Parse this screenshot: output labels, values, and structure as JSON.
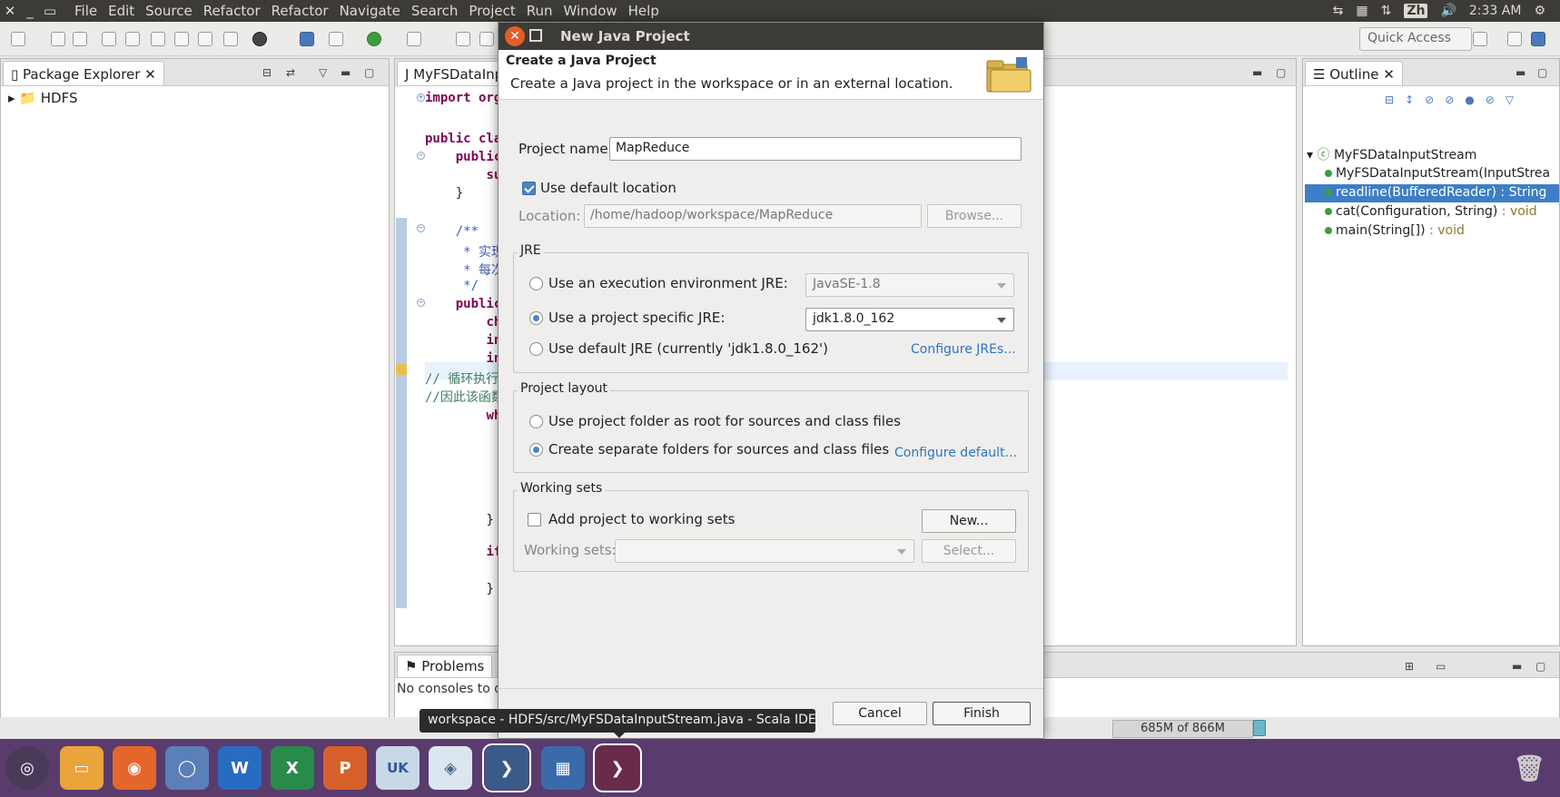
{
  "menubar": {
    "items": [
      "File",
      "Edit",
      "Source",
      "Refactor",
      "Refactor",
      "Navigate",
      "Search",
      "Project",
      "Run",
      "Window",
      "Help"
    ],
    "ime": "Zh",
    "clock": "2:33 AM"
  },
  "toolbar": {
    "quick_access": "Quick Access"
  },
  "package_explorer": {
    "tab": "Package Explorer",
    "tree": [
      {
        "label": "HDFS"
      }
    ]
  },
  "editor": {
    "tab": "MyFSDataInp",
    "lines": [
      "import org",
      "public cla",
      "public",
      "su",
      "}",
      "/**",
      "* 实现",
      "* 每次",
      "*/",
      "public",
      "ch",
      "in",
      "in",
      "// 循环执行",
      "//因此该函数",
      "wh",
      "}",
      "if",
      "}"
    ]
  },
  "outline": {
    "tab": "Outline",
    "items": [
      {
        "name": "MyFSDataInputStream",
        "ret": ""
      },
      {
        "name": "MyFSDataInputStream(InputStrea",
        "ret": ""
      },
      {
        "name": "readline(BufferedReader)",
        "ret": ": String"
      },
      {
        "name": "cat(Configuration, String)",
        "ret": ": void"
      },
      {
        "name": "main(String[])",
        "ret": ": void"
      }
    ]
  },
  "problems": {
    "tab": "Problems",
    "message": "No consoles to d"
  },
  "status": {
    "heap": "685M of 866M"
  },
  "dialog": {
    "title": "New Java Project",
    "header_title": "Create a Java Project",
    "header_desc": "Create a Java project in the workspace or in an external location.",
    "project_name_label": "Project name:",
    "project_name": "MapReduce",
    "use_default_location": "Use default location",
    "location_label": "Location:",
    "location": "/home/hadoop/workspace/MapReduce",
    "browse": "Browse...",
    "jre": {
      "title": "JRE",
      "exec_env": "Use an execution environment JRE:",
      "exec_env_value": "JavaSE-1.8",
      "project_specific": "Use a project specific JRE:",
      "project_specific_value": "jdk1.8.0_162",
      "default_jre": "Use default JRE (currently 'jdk1.8.0_162')",
      "configure": "Configure JREs..."
    },
    "layout": {
      "title": "Project layout",
      "root": "Use project folder as root for sources and class files",
      "separate": "Create separate folders for sources and class files",
      "configure": "Configure default..."
    },
    "working_sets": {
      "title": "Working sets",
      "add": "Add project to working sets",
      "new": "New...",
      "label": "Working sets:",
      "select": "Select..."
    },
    "cancel": "Cancel",
    "finish": "Finish"
  },
  "tooltip": "workspace - HDFS/src/MyFSDataInputStream.java - Scala IDE",
  "dock": {
    "uk_badge": "UK"
  }
}
